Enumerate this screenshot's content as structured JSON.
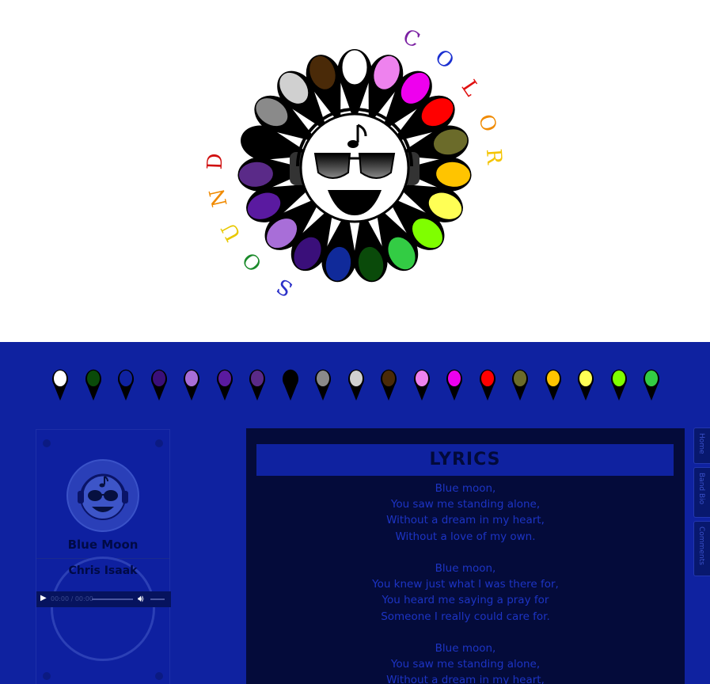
{
  "logo": {
    "word_color": [
      "C",
      "O",
      "L",
      "O",
      "R"
    ],
    "word_sound": [
      "S",
      "O",
      "U",
      "N",
      "D"
    ],
    "color_letter_colors": [
      "#7a1fa2",
      "#1a2fd0",
      "#e01010",
      "#f08a00",
      "#f4c400"
    ],
    "sound_letter_colors": [
      "#2a2fc8",
      "#1a8a2a",
      "#e8c800",
      "#f08a00",
      "#d01010"
    ],
    "petal_colors": [
      "#ffffff",
      "#ee82ee",
      "#ee00ee",
      "#ff0000",
      "#6b6b2a",
      "#ffc400",
      "#ffff55",
      "#7fff00",
      "#33cc44",
      "#0a4a0a",
      "#102a9a",
      "#3a0f7a",
      "#a86ed8",
      "#5a1aa0",
      "#5a2a88",
      "#000000",
      "#8a8a8a",
      "#d0d0d0",
      "#4a2a08"
    ],
    "note_icon": "music-note-icon"
  },
  "color_picks": [
    "#ffffff",
    "#0a4a0a",
    "#0f22a0",
    "#3a0f7a",
    "#a86ed8",
    "#5a1aa0",
    "#5a2a88",
    "#000000",
    "#8a8a8a",
    "#d0d0d0",
    "#4a2a08",
    "#ee82ee",
    "#ee00ee",
    "#ff0000",
    "#6b6b2a",
    "#ffc400",
    "#ffff55",
    "#7fff00",
    "#33cc44"
  ],
  "player": {
    "song_title": "Blue Moon",
    "artist": "Chris Isaak",
    "time_display": "00:00 / 00:00",
    "play_icon": "play-icon",
    "volume_icon": "volume-icon"
  },
  "lyrics": {
    "header": "LYRICS",
    "stanzas": [
      [
        "Blue moon,",
        "You saw me standing alone,",
        "Without a dream in my heart,",
        "Without a love of my own."
      ],
      [
        "Blue moon,",
        "You knew just what I was there for,",
        "You heard me saying a pray for",
        "Someone I really could care for."
      ],
      [
        "Blue moon,",
        "You saw me standing alone,",
        "Without a dream in my heart,"
      ]
    ]
  },
  "nav": {
    "tabs": [
      "Home",
      "Band Bio",
      "Comments"
    ]
  },
  "colors": {
    "page_bg": "#0f22a0",
    "lyrics_bg": "#040b3a",
    "lyrics_text": "#1d34c4"
  }
}
